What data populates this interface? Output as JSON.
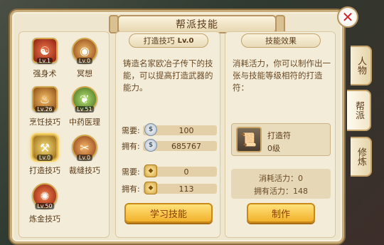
{
  "window": {
    "title": "帮派技能",
    "close_icon": "close-icon"
  },
  "skills": [
    {
      "name": "强身术",
      "level": "Lv.1",
      "icon": "strength-icon",
      "color": "#c93a2a"
    },
    {
      "name": "冥想",
      "level": "Lv.0",
      "icon": "meditation-icon",
      "color": "#b8671f"
    },
    {
      "name": "烹饪技巧",
      "level": "Lv.26",
      "icon": "cooking-icon",
      "color": "#b5752c"
    },
    {
      "name": "中药医理",
      "level": "Lv.51",
      "icon": "medicine-icon",
      "color": "#6aa030"
    },
    {
      "name": "打造技巧",
      "level": "Lv.0",
      "icon": "forging-icon",
      "color": "#c99b2a"
    },
    {
      "name": "裁缝技巧",
      "level": "Lv.0",
      "icon": "tailoring-icon",
      "color": "#c56b2a"
    },
    {
      "name": "炼金技巧",
      "level": "Lv.50",
      "icon": "alchemy-icon",
      "color": "#c8392a"
    }
  ],
  "selected_skill": {
    "name": "打造技巧",
    "level": "Lv.0",
    "description": "铸造名家欧冶子传下的技能，可以提高打造武器的能力。"
  },
  "cost": {
    "need_label": "需要:",
    "have_label": "拥有:",
    "silver_need": "100",
    "silver_have": "685767",
    "gold_need": "0",
    "gold_have": "113"
  },
  "learn_button": "学习技能",
  "effect": {
    "title": "技能效果",
    "description": "消耗活力，你可以制作出一张与技能等级相符的打造符：",
    "product_name": "打造符",
    "product_level": "0级",
    "vitality_cost": "消耗活力：0",
    "vitality_have": "拥有活力：148"
  },
  "make_button": "制作",
  "tabs": [
    "人物",
    "帮派",
    "修炼"
  ]
}
